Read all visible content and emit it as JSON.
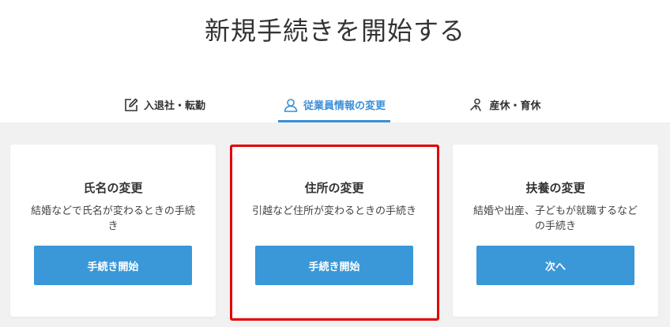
{
  "page": {
    "title": "新規手続きを開始する"
  },
  "tabs": [
    {
      "label": "入退社・転勤",
      "icon": "edit-icon"
    },
    {
      "label": "従業員情報の変更",
      "icon": "user-icon",
      "active": true
    },
    {
      "label": "産休・育休",
      "icon": "baby-icon"
    }
  ],
  "cards": [
    {
      "title": "氏名の変更",
      "description": "結婚などで氏名が変わるときの手続き",
      "button_label": "手続き開始"
    },
    {
      "title": "住所の変更",
      "description": "引越など住所が変わるときの手続き",
      "button_label": "手続き開始",
      "highlighted": true
    },
    {
      "title": "扶養の変更",
      "description": "結婚や出産、子どもが就職するなどの手続き",
      "button_label": "次へ"
    }
  ],
  "colors": {
    "accent": "#3a8fd6",
    "button": "#3a97d8",
    "highlight": "#e30000",
    "background": "#f1f1f1"
  }
}
